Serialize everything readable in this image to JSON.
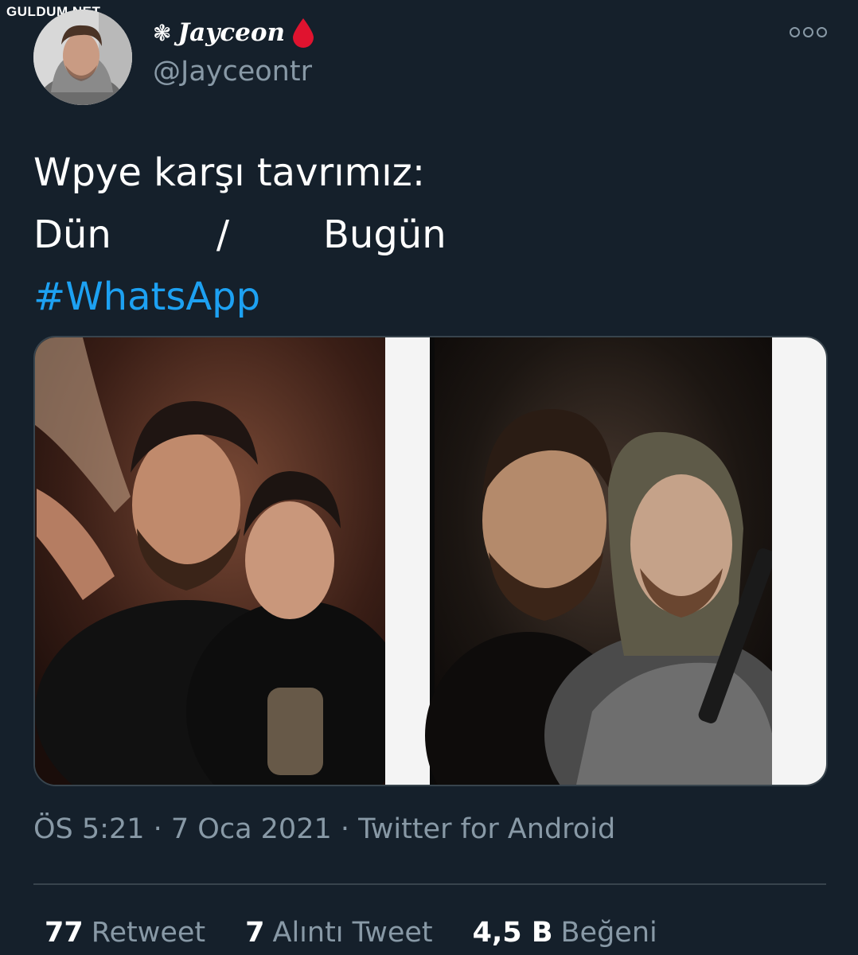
{
  "watermark": "GULDUM.NET",
  "user": {
    "display_name": "Jayceon",
    "flower_symbol": "❃",
    "handle": "@Jayceontr"
  },
  "tweet": {
    "line1": "Wpye karşı tavrımız:",
    "line2_left": "Dün",
    "line2_mid": "/",
    "line2_right": "Bugün",
    "hashtag": "#WhatsApp"
  },
  "meta": {
    "time": "ÖS 5:21",
    "date": "7 Oca 2021",
    "source": "Twitter for Android"
  },
  "stats": [
    {
      "count": "77",
      "label": "Retweet"
    },
    {
      "count": "7",
      "label": "Alıntı Tweet"
    },
    {
      "count": "4,5 B",
      "label": "Beğeni"
    }
  ],
  "colors": {
    "background": "#15202b",
    "hashtag": "#1da1f2",
    "secondary_text": "#8899a6",
    "drop_icon": "#e0132f"
  }
}
